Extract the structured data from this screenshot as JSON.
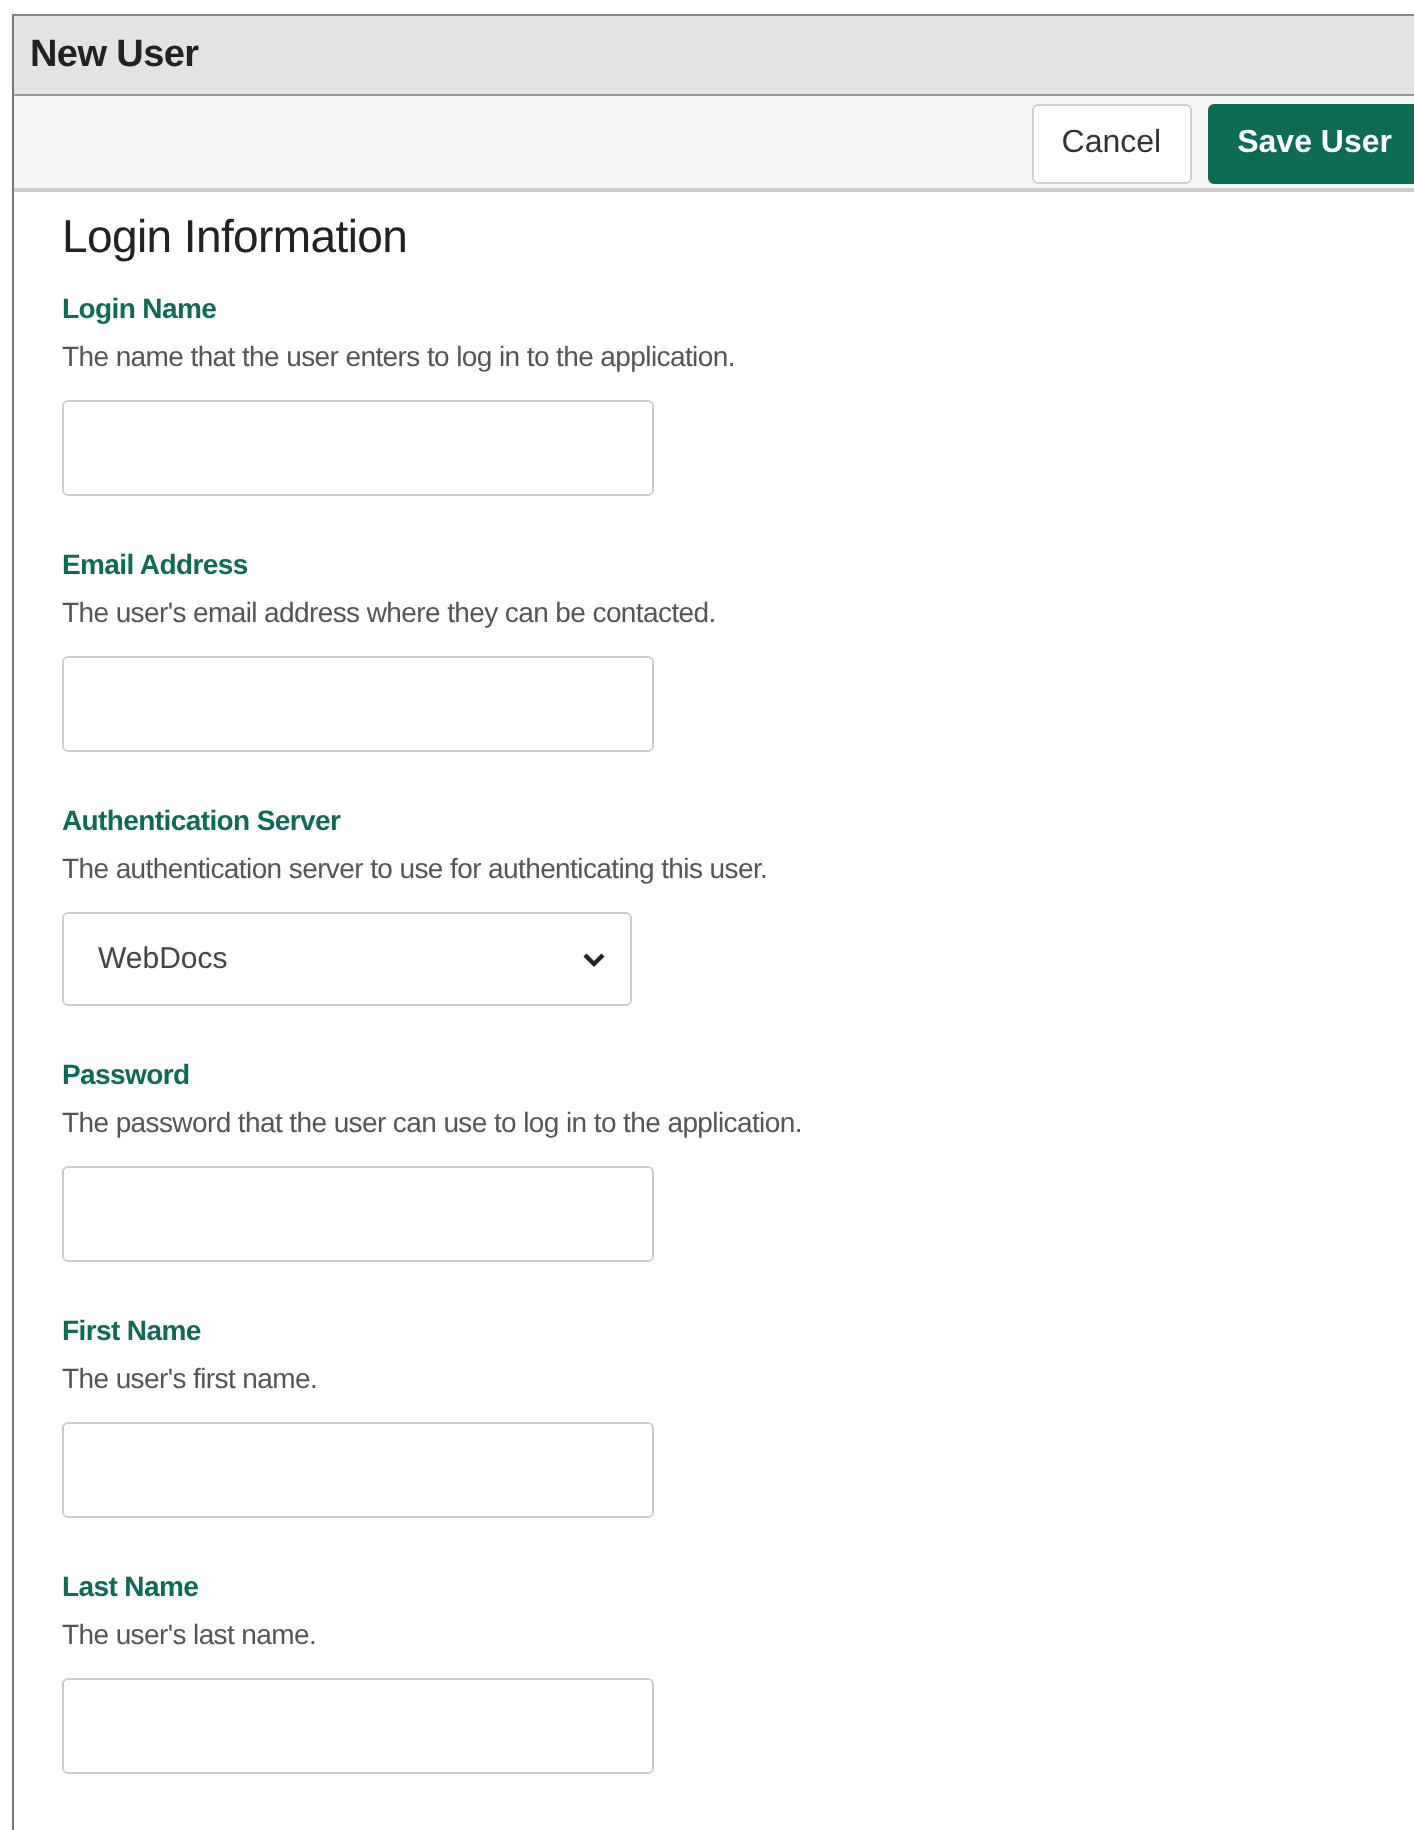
{
  "window": {
    "title": "New User"
  },
  "toolbar": {
    "buttons": [
      {
        "label": "Cancel",
        "kind": "secondary"
      },
      {
        "label": "Save User",
        "kind": "primary"
      }
    ]
  },
  "section": {
    "heading": "Login Information"
  },
  "fields": [
    {
      "kind": "text",
      "label": "Login Name",
      "description": "The name that the user enters to log in to the application."
    },
    {
      "kind": "text",
      "label": "Email Address",
      "description": "The user's email address where they can be contacted."
    },
    {
      "kind": "select",
      "label": "Authentication Server",
      "description": "The authentication server to use for authenticating this user.",
      "value": "WebDocs"
    },
    {
      "kind": "text",
      "label": "Password",
      "description": "The password that the user can use to log in to the application."
    },
    {
      "kind": "text",
      "label": "First Name",
      "description": "The user's first name."
    },
    {
      "kind": "text",
      "label": "Last Name",
      "description": "The user's last name."
    }
  ]
}
